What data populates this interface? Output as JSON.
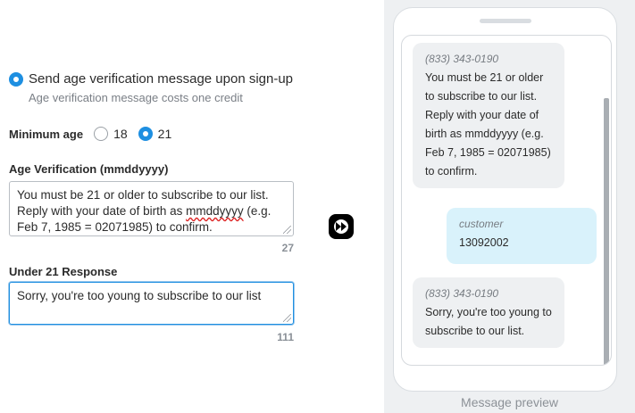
{
  "settings": {
    "send_label": "Send age verification message upon sign-up",
    "send_sub": "Age verification message costs one credit",
    "min_age_label": "Minimum age",
    "min_age_options": [
      "18",
      "21"
    ],
    "min_age_selected": "21"
  },
  "age_verification": {
    "label": "Age Verification (mmddyyyy)",
    "value_pre": "You must be 21 or older to subscribe to our list. Reply with your date of birth as ",
    "value_flag": "mmddyyyy",
    "value_post": " (e.g. Feb 7, 1985 = 02071985) to confirm.",
    "counter": "27"
  },
  "under21": {
    "label": "Under 21 Response",
    "value": "Sorry, you're too young to subscribe to our list",
    "counter": "111"
  },
  "preview": {
    "caption": "Message preview",
    "messages": [
      {
        "from": "(833) 343-0190",
        "text": "You must be 21 or older to subscribe to our list. Reply with your date of birth as mmddyyyy (e.g. Feb 7, 1985 = 02071985) to confirm."
      },
      {
        "from": "customer",
        "text": "13092002"
      },
      {
        "from": "(833) 343-0190",
        "text": "Sorry, you're too young to subscribe to our list."
      }
    ]
  },
  "colors": {
    "accent": "#1e8fe1",
    "customer_bubble": "#d9f2fb",
    "incoming_bubble": "#eef0f2"
  }
}
